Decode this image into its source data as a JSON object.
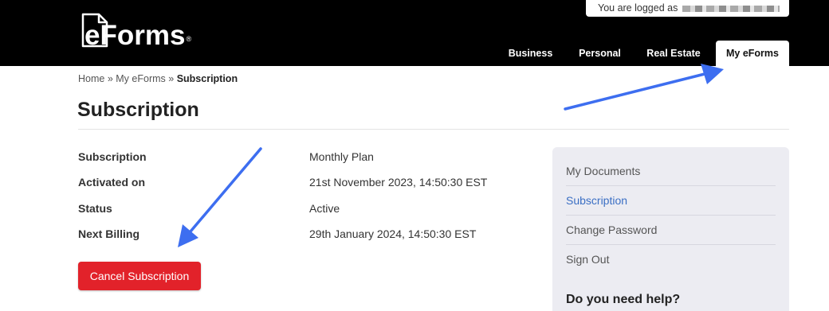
{
  "header": {
    "logo_text": "eForms",
    "logo_mark": "®",
    "login_text": "You are logged as",
    "nav": [
      {
        "label": "Business"
      },
      {
        "label": "Personal"
      },
      {
        "label": "Real Estate"
      },
      {
        "label": "My eForms"
      }
    ]
  },
  "breadcrumb": {
    "home": "Home",
    "sep1": "»",
    "parent": "My eForms",
    "sep2": "»",
    "current": "Subscription"
  },
  "page_title": "Subscription",
  "details": [
    {
      "label": "Subscription",
      "value": "Monthly Plan"
    },
    {
      "label": "Activated on",
      "value": "21st November 2023, 14:50:30 EST"
    },
    {
      "label": "Status",
      "value": "Active"
    },
    {
      "label": "Next Billing",
      "value": "29th January 2024, 14:50:30 EST"
    }
  ],
  "cancel_button": "Cancel Subscription",
  "sidebar": {
    "items": [
      {
        "label": "My Documents"
      },
      {
        "label": "Subscription"
      },
      {
        "label": "Change Password"
      },
      {
        "label": "Sign Out"
      }
    ],
    "help_title": "Do you need help?"
  },
  "colors": {
    "header_bg": "#000000",
    "cancel_button": "#e2222a",
    "active_link": "#3b6fc4",
    "sidebar_bg": "#ececf2",
    "annotation_arrow": "#3d6ef0"
  },
  "icons": [
    "document-logo-icon",
    "annotation-arrow-icon"
  ]
}
